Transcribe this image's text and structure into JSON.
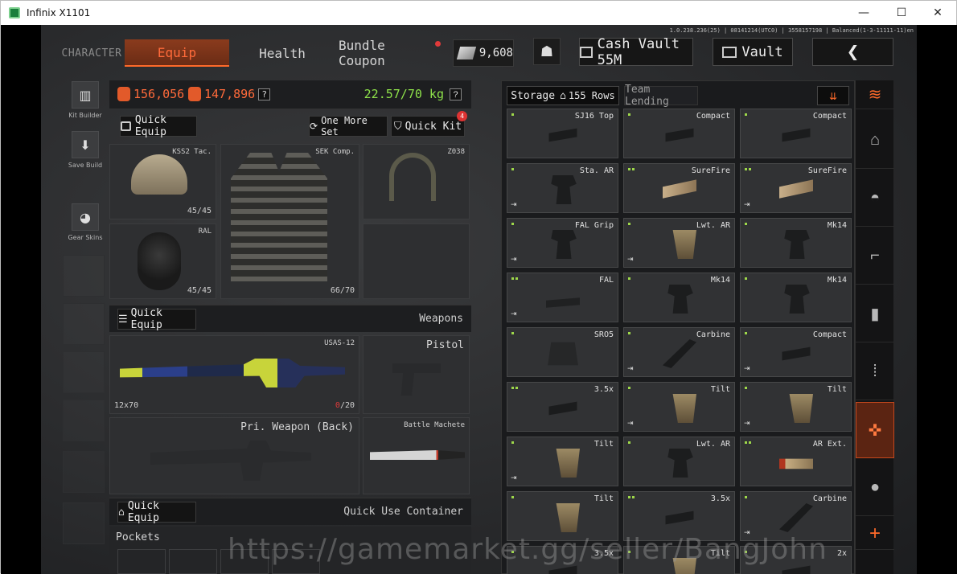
{
  "window": {
    "title": "Infinix X1101",
    "controls": {
      "minimize": "—",
      "maximize": "☐",
      "close": "✕"
    }
  },
  "version_info": "1.0.238.236(25) | 08141214(UTC0) | 3558157198 | Balanced(1-3-11111-11)en",
  "nav": {
    "character": "CHARACTER",
    "equip": "Equip",
    "health": "Health",
    "bundle_coupon": "Bundle Coupon",
    "currency": "9,608",
    "cash_vault": "Cash Vault 55M",
    "vault": "Vault",
    "back": "❮"
  },
  "left_menu": {
    "kit_builder": "Kit Builder",
    "save_build": "Save Build",
    "gear_skins": "Gear Skins"
  },
  "stats": {
    "value1": "156,056",
    "value2": "147,896",
    "help": "?",
    "weight": "22.57/70 kg",
    "weight_help": "?"
  },
  "equip_buttons": {
    "quick_equip": "Quick Equip",
    "one_more_set": "One More Set",
    "quick_kit": "Quick Kit",
    "quick_kit_badge": "4"
  },
  "gear": {
    "helmet": {
      "name": "KSS2 Tac.",
      "count": "45/45"
    },
    "mask": {
      "name": "RAL",
      "count": "45/45"
    },
    "armor": {
      "name": "SEK Comp.",
      "count": "66/70"
    },
    "headset": {
      "name": "Z038"
    }
  },
  "weapons": {
    "section_title": "Weapons",
    "quick_equip": "Quick Equip",
    "primary": {
      "name": "USAS-12",
      "ammo": "12x70",
      "mag_loaded": "0",
      "mag_total": "/20"
    },
    "pistol": "Pistol",
    "pri_back": "Pri. Weapon (Back)",
    "melee": "Battle Machete"
  },
  "quick_use": {
    "quick_equip": "Quick Equip",
    "title": "Quick Use Container",
    "pockets": "Pockets"
  },
  "storage": {
    "tab_storage": "Storage",
    "rows": "155 Rows",
    "tab_team": "Team Lending",
    "items": [
      {
        "name": "SJ16 Top",
        "shape": "scope",
        "tier": 1,
        "xfer": false
      },
      {
        "name": "Compact",
        "shape": "scope",
        "tier": 1,
        "xfer": false
      },
      {
        "name": "Compact",
        "shape": "scope",
        "tier": 1,
        "xfer": false
      },
      {
        "name": "Sta. AR",
        "shape": "grip",
        "tier": 1,
        "xfer": true
      },
      {
        "name": "SureFire",
        "shape": "light",
        "tier": 2,
        "xfer": false
      },
      {
        "name": "SureFire",
        "shape": "light",
        "tier": 2,
        "xfer": true
      },
      {
        "name": "FAL Grip",
        "shape": "grip",
        "tier": 1,
        "xfer": true
      },
      {
        "name": "Lwt. AR",
        "shape": "gripk",
        "tier": 1,
        "xfer": true
      },
      {
        "name": "Mk14",
        "shape": "grip",
        "tier": 1,
        "xfer": false
      },
      {
        "name": "FAL",
        "shape": "rail",
        "tier": 2,
        "xfer": true
      },
      {
        "name": "Mk14",
        "shape": "grip",
        "tier": 1,
        "xfer": false
      },
      {
        "name": "Mk14",
        "shape": "grip",
        "tier": 1,
        "xfer": false
      },
      {
        "name": "SRO5",
        "shape": "red",
        "tier": 1,
        "xfer": false
      },
      {
        "name": "Carbine",
        "shape": "plate",
        "tier": 1,
        "xfer": true
      },
      {
        "name": "Compact",
        "shape": "scope",
        "tier": 1,
        "xfer": true
      },
      {
        "name": "3.5x",
        "shape": "scope",
        "tier": 2,
        "xfer": false
      },
      {
        "name": "Tilt",
        "shape": "gripk",
        "tier": 1,
        "xfer": true
      },
      {
        "name": "Tilt",
        "shape": "gripk",
        "tier": 1,
        "xfer": true
      },
      {
        "name": "Tilt",
        "shape": "gripk",
        "tier": 1,
        "xfer": true
      },
      {
        "name": "Lwt. AR",
        "shape": "grip",
        "tier": 1,
        "xfer": false
      },
      {
        "name": "AR Ext.",
        "shape": "tube",
        "tier": 2,
        "xfer": false
      },
      {
        "name": "Tilt",
        "shape": "gripk",
        "tier": 1,
        "xfer": false
      },
      {
        "name": "3.5x",
        "shape": "scope",
        "tier": 2,
        "xfer": false
      },
      {
        "name": "Carbine",
        "shape": "plate",
        "tier": 1,
        "xfer": true
      },
      {
        "name": "3.5x",
        "shape": "scope",
        "tier": 1,
        "xfer": false
      },
      {
        "name": "Tilt",
        "shape": "gripk",
        "tier": 1,
        "xfer": false
      },
      {
        "name": "2x",
        "shape": "scope",
        "tier": 1,
        "xfer": false
      }
    ]
  },
  "categories": [
    "stack-icon",
    "home-icon",
    "helmet-icon",
    "rifle-icon",
    "magazine-icon",
    "ammo-icon",
    "attachment-icon",
    "grenade-icon",
    "plus-icon"
  ],
  "watermark": "https://gamemarket.gg/seller/BangJohn",
  "colors": {
    "accent": "#ff6a2a",
    "weight_ok": "#8ee24a",
    "tier": "#9ed84a"
  }
}
